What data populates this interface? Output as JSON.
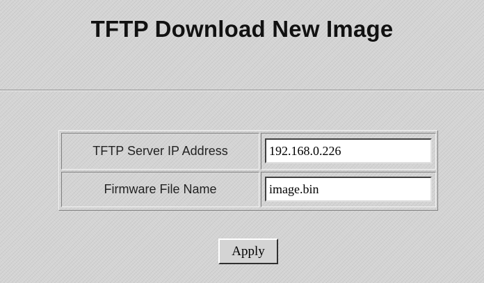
{
  "page": {
    "title": "TFTP Download New Image"
  },
  "form": {
    "fields": [
      {
        "label": "TFTP Server IP Address",
        "value": "192.168.0.226"
      },
      {
        "label": "Firmware File Name",
        "value": "image.bin"
      }
    ],
    "apply_label": "Apply"
  },
  "colors": {
    "background": "#d4d4d4",
    "field_background": "#ffffff",
    "text": "#111111"
  }
}
